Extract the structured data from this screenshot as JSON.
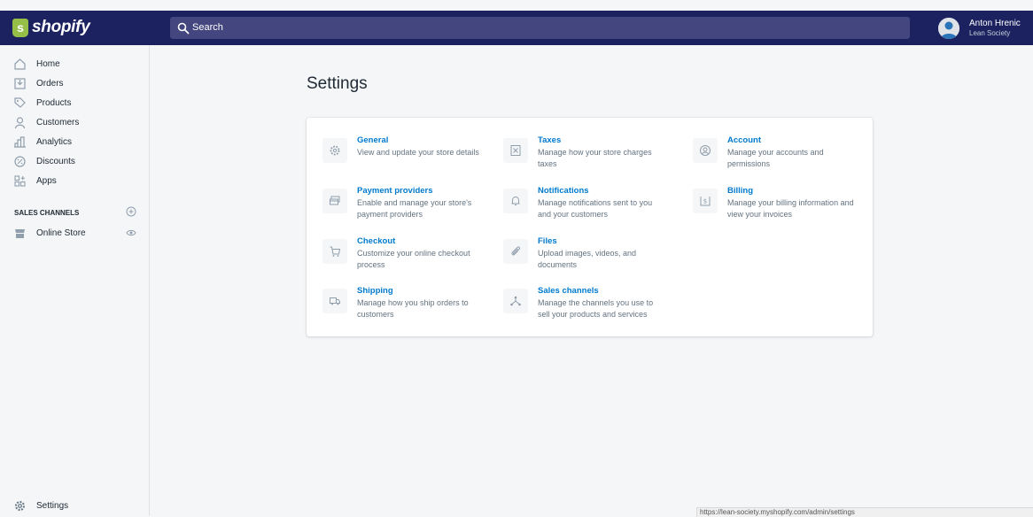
{
  "brand": {
    "name": "shopify",
    "icon_letter": "s",
    "color": "#95bf47"
  },
  "topbar": {
    "background": "#1c2260",
    "search_placeholder": "Search"
  },
  "user": {
    "name": "Anton Hrenic",
    "store": "Lean Society"
  },
  "sidebar": {
    "items": [
      {
        "label": "Home",
        "icon": "home-icon"
      },
      {
        "label": "Orders",
        "icon": "orders-icon"
      },
      {
        "label": "Products",
        "icon": "tag-icon"
      },
      {
        "label": "Customers",
        "icon": "person-icon"
      },
      {
        "label": "Analytics",
        "icon": "bar-chart-icon"
      },
      {
        "label": "Discounts",
        "icon": "discount-icon"
      },
      {
        "label": "Apps",
        "icon": "apps-icon"
      }
    ],
    "sales_channels_title": "SALES CHANNELS",
    "online_store_label": "Online Store",
    "settings_label": "Settings"
  },
  "main": {
    "title": "Settings",
    "settings": [
      {
        "title": "General",
        "desc": "View and update your store details",
        "icon": "gear-icon"
      },
      {
        "title": "Taxes",
        "desc": "Manage how your store charges taxes",
        "icon": "taxes-icon"
      },
      {
        "title": "Account",
        "desc": "Manage your accounts and permissions",
        "icon": "account-icon"
      },
      {
        "title": "Payment providers",
        "desc": "Enable and manage your store's payment providers",
        "icon": "payment-icon"
      },
      {
        "title": "Notifications",
        "desc": "Manage notifications sent to you and your customers",
        "icon": "bell-icon"
      },
      {
        "title": "Billing",
        "desc": "Manage your billing information and view your invoices",
        "icon": "billing-icon"
      },
      {
        "title": "Checkout",
        "desc": "Customize your online checkout process",
        "icon": "cart-icon"
      },
      {
        "title": "Files",
        "desc": "Upload images, videos, and documents",
        "icon": "paperclip-icon"
      },
      {
        "title": "Shipping",
        "desc": "Manage how you ship orders to customers",
        "icon": "truck-icon"
      },
      {
        "title": "Sales channels",
        "desc": "Manage the channels you use to sell your products and services",
        "icon": "channels-icon"
      }
    ]
  },
  "status_bar": {
    "url": "https://lean-society.myshopify.com/admin/settings"
  }
}
